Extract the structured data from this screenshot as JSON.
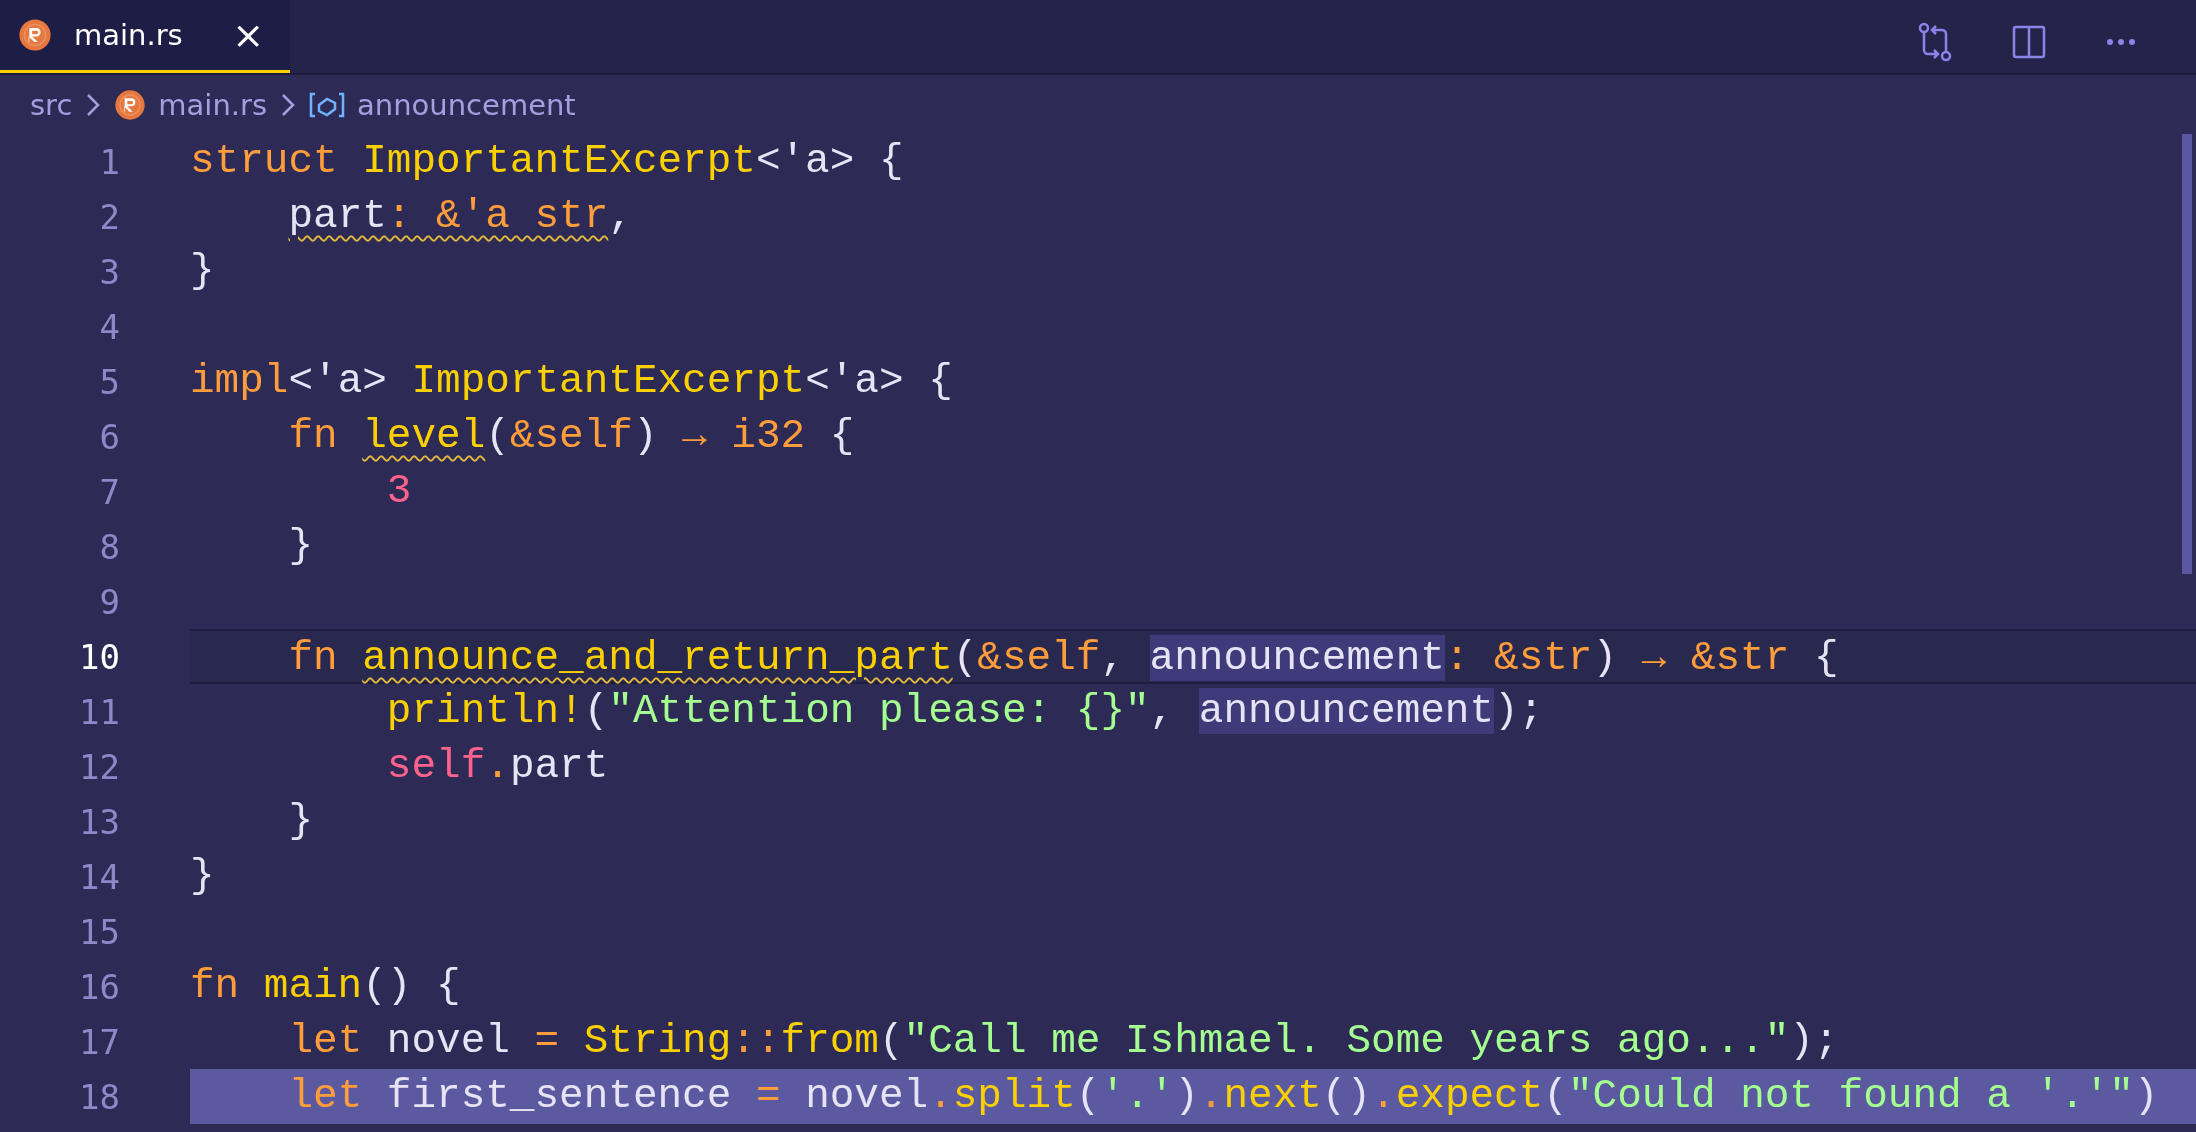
{
  "tab": {
    "label": "main.rs",
    "selected": true,
    "close": "×"
  },
  "breadcrumbs": [
    {
      "label": "src",
      "kind": "folder"
    },
    {
      "label": "main.rs",
      "kind": "file"
    },
    {
      "label": "announcement",
      "kind": "symbol"
    }
  ],
  "editor": {
    "lines": [
      {
        "number": "1",
        "current": false,
        "selected": false,
        "tokens": [
          {
            "text": "struct ",
            "kind": "keyword",
            "warning": false,
            "highlighted": false
          },
          {
            "text": "ImportantExcerpt",
            "kind": "type",
            "warning": false,
            "highlighted": false
          },
          {
            "text": "<'a> {",
            "kind": "plain",
            "warning": false,
            "highlighted": false
          }
        ]
      },
      {
        "number": "2",
        "current": false,
        "selected": false,
        "tokens": [
          {
            "text": "    part",
            "kind": "plain",
            "warning": true,
            "highlighted": false
          },
          {
            "text": ": &'a str",
            "kind": "operator",
            "warning": true,
            "highlighted": false
          },
          {
            "text": ",",
            "kind": "plain",
            "warning": false,
            "highlighted": false
          }
        ]
      },
      {
        "number": "3",
        "current": false,
        "selected": false,
        "tokens": [
          {
            "text": "}",
            "kind": "plain",
            "warning": false,
            "highlighted": false
          }
        ]
      },
      {
        "number": "4",
        "current": false,
        "selected": false
      },
      {
        "number": "5",
        "current": false,
        "selected": false,
        "tokens": [
          {
            "text": "impl",
            "kind": "keyword",
            "warning": false,
            "highlighted": false
          },
          {
            "text": "<'a> ",
            "kind": "plain",
            "warning": false,
            "highlighted": false
          },
          {
            "text": "ImportantExcerpt",
            "kind": "type",
            "warning": false,
            "highlighted": false
          },
          {
            "text": "<'a> {",
            "kind": "plain",
            "warning": false,
            "highlighted": false
          }
        ]
      },
      {
        "number": "6",
        "current": false,
        "selected": false,
        "tokens": [
          {
            "text": "    fn ",
            "kind": "keyword",
            "warning": false,
            "highlighted": false
          },
          {
            "text": "level",
            "kind": "function",
            "warning": true,
            "highlighted": false
          },
          {
            "text": "(",
            "kind": "plain",
            "warning": false,
            "highlighted": false
          },
          {
            "text": "&self",
            "kind": "operator",
            "warning": false,
            "highlighted": false
          },
          {
            "text": ") ",
            "kind": "plain",
            "warning": false,
            "highlighted": false
          },
          {
            "text": "→ i32",
            "kind": "operator",
            "warning": false,
            "highlighted": false
          },
          {
            "text": " {",
            "kind": "plain",
            "warning": false,
            "highlighted": false
          }
        ]
      },
      {
        "number": "7",
        "current": false,
        "selected": false,
        "tokens": [
          {
            "text": "        3",
            "kind": "number",
            "warning": false,
            "highlighted": false
          }
        ]
      },
      {
        "number": "8",
        "current": false,
        "selected": false,
        "tokens": [
          {
            "text": "    }",
            "kind": "plain",
            "warning": false,
            "highlighted": false
          }
        ]
      },
      {
        "number": "9",
        "current": false,
        "selected": false
      },
      {
        "number": "10",
        "current": true,
        "selected": false,
        "tokens": [
          {
            "text": "    fn ",
            "kind": "keyword",
            "warning": false,
            "highlighted": false
          },
          {
            "text": "announce_and_return_part",
            "kind": "function",
            "warning": true,
            "highlighted": false
          },
          {
            "text": "(",
            "kind": "plain",
            "warning": false,
            "highlighted": false
          },
          {
            "text": "&self",
            "kind": "operator",
            "warning": false,
            "highlighted": false
          },
          {
            "text": ", ",
            "kind": "plain",
            "warning": false,
            "highlighted": false
          },
          {
            "text": "announcement",
            "kind": "plain",
            "warning": false,
            "highlighted": true
          },
          {
            "text": ": &str",
            "kind": "operator",
            "warning": false,
            "highlighted": false
          },
          {
            "text": ") ",
            "kind": "plain",
            "warning": false,
            "highlighted": false
          },
          {
            "text": "→ &str",
            "kind": "operator",
            "warning": false,
            "highlighted": false
          },
          {
            "text": " {",
            "kind": "plain",
            "warning": false,
            "highlighted": false
          }
        ]
      },
      {
        "number": "11",
        "current": false,
        "selected": false,
        "tokens": [
          {
            "text": "        println!",
            "kind": "function",
            "warning": false,
            "highlighted": false
          },
          {
            "text": "(",
            "kind": "plain",
            "warning": false,
            "highlighted": false
          },
          {
            "text": "\"Attention please: {}\"",
            "kind": "string",
            "warning": false,
            "highlighted": false
          },
          {
            "text": ", ",
            "kind": "plain",
            "warning": false,
            "highlighted": false
          },
          {
            "text": "announcement",
            "kind": "plain",
            "warning": false,
            "highlighted": true
          },
          {
            "text": ");",
            "kind": "plain",
            "warning": false,
            "highlighted": false
          }
        ]
      },
      {
        "number": "12",
        "current": false,
        "selected": false,
        "tokens": [
          {
            "text": "        self",
            "kind": "self",
            "warning": false,
            "highlighted": false
          },
          {
            "text": ".",
            "kind": "operator",
            "warning": false,
            "highlighted": false
          },
          {
            "text": "part",
            "kind": "plain",
            "warning": false,
            "highlighted": false
          }
        ]
      },
      {
        "number": "13",
        "current": false,
        "selected": false,
        "tokens": [
          {
            "text": "    }",
            "kind": "plain",
            "warning": false,
            "highlighted": false
          }
        ]
      },
      {
        "number": "14",
        "current": false,
        "selected": false,
        "tokens": [
          {
            "text": "}",
            "kind": "plain",
            "warning": false,
            "highlighted": false
          }
        ]
      },
      {
        "number": "15",
        "current": false,
        "selected": false
      },
      {
        "number": "16",
        "current": false,
        "selected": false,
        "tokens": [
          {
            "text": "fn ",
            "kind": "keyword",
            "warning": false,
            "highlighted": false
          },
          {
            "text": "main",
            "kind": "function",
            "warning": false,
            "highlighted": false
          },
          {
            "text": "() {",
            "kind": "plain",
            "warning": false,
            "highlighted": false
          }
        ]
      },
      {
        "number": "17",
        "current": false,
        "selected": false,
        "tokens": [
          {
            "text": "    let",
            "kind": "keyword",
            "warning": false,
            "highlighted": false
          },
          {
            "text": " novel ",
            "kind": "plain",
            "warning": false,
            "highlighted": false
          },
          {
            "text": "=",
            "kind": "operator",
            "warning": false,
            "highlighted": false
          },
          {
            "text": " String",
            "kind": "type",
            "warning": false,
            "highlighted": false
          },
          {
            "text": "::",
            "kind": "operator",
            "warning": false,
            "highlighted": false
          },
          {
            "text": "from",
            "kind": "function",
            "warning": false,
            "highlighted": false
          },
          {
            "text": "(",
            "kind": "plain",
            "warning": false,
            "highlighted": false
          },
          {
            "text": "\"Call me Ishmael. Some years ago...\"",
            "kind": "string",
            "warning": false,
            "highlighted": false
          },
          {
            "text": ");",
            "kind": "plain",
            "warning": false,
            "highlighted": false
          }
        ]
      },
      {
        "number": "18",
        "current": false,
        "selected": true,
        "tokens": [
          {
            "text": "    let",
            "kind": "keyword",
            "warning": false,
            "highlighted": false
          },
          {
            "text": " first_sentence ",
            "kind": "plain",
            "warning": false,
            "highlighted": false
          },
          {
            "text": "=",
            "kind": "operator",
            "warning": false,
            "highlighted": false
          },
          {
            "text": " novel",
            "kind": "plain",
            "warning": false,
            "highlighted": false
          },
          {
            "text": ".",
            "kind": "operator",
            "warning": false,
            "highlighted": false
          },
          {
            "text": "split",
            "kind": "function",
            "warning": false,
            "highlighted": false
          },
          {
            "text": "(",
            "kind": "plain",
            "warning": false,
            "highlighted": false
          },
          {
            "text": "'.'",
            "kind": "string",
            "warning": false,
            "highlighted": false
          },
          {
            "text": ")",
            "kind": "plain",
            "warning": false,
            "highlighted": false
          },
          {
            "text": ".",
            "kind": "operator",
            "warning": false,
            "highlighted": false
          },
          {
            "text": "next",
            "kind": "function",
            "warning": false,
            "highlighted": false
          },
          {
            "text": "()",
            "kind": "plain",
            "warning": false,
            "highlighted": false
          },
          {
            "text": ".",
            "kind": "operator",
            "warning": false,
            "highlighted": false
          },
          {
            "text": "expect",
            "kind": "function",
            "warning": false,
            "highlighted": false
          },
          {
            "text": "(",
            "kind": "plain",
            "warning": false,
            "highlighted": false
          },
          {
            "text": "\"Could not found a '.'\"",
            "kind": "string",
            "warning": false,
            "highlighted": false
          },
          {
            "text": ")",
            "kind": "plain",
            "warning": false,
            "highlighted": false
          }
        ]
      }
    ]
  }
}
